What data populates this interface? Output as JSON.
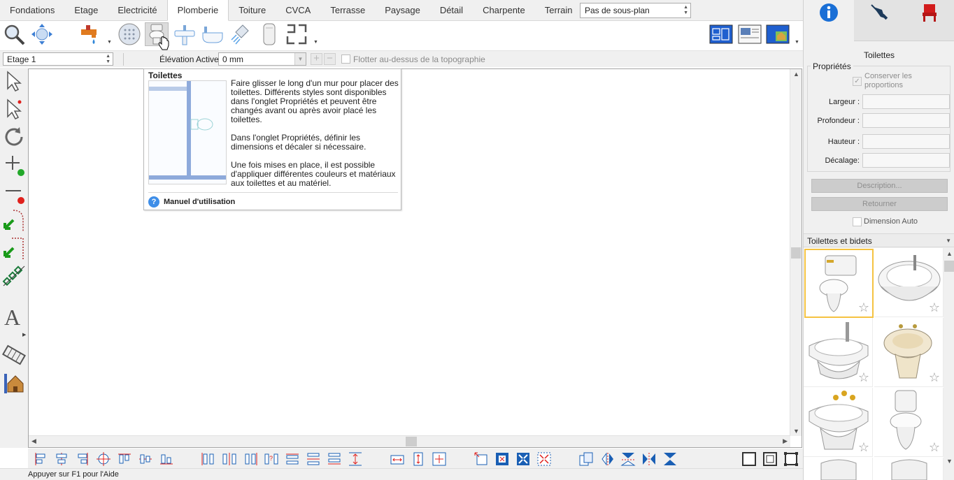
{
  "tabs": [
    "Fondations",
    "Etage",
    "Electricité",
    "Plomberie",
    "Toiture",
    "CVCA",
    "Terrasse",
    "Paysage",
    "Détail",
    "Charpente",
    "Terrain"
  ],
  "active_tab": "Plomberie",
  "plan_select": "Pas de sous-plan",
  "options": {
    "floor": "Etage 1",
    "elevation_label": "Élévation Active:",
    "elevation_value": "0 mm",
    "float_label": "Flotter au-dessus de la topographie"
  },
  "tooltip": {
    "title": "Toilettes",
    "p1": "Faire glisser le long d'un mur pour placer des toilettes. Différents styles sont disponibles dans l'onglet Propriétés et peuvent être changés avant ou après avoir placé les toilettes.",
    "p2": "Dans l'onglet Propriétés, définir les dimensions et décaler si nécessaire.",
    "p3": "Une fois mises en place, il est possible d'appliquer différentes couleurs et matériaux aux toilettes et au matériel.",
    "help": "Manuel d'utilisation"
  },
  "status": "Appuyer sur F1 pour l'Aide",
  "panel": {
    "object_name": "Toilettes",
    "props_title": "Propriétés",
    "keep_proportions": "Conserver les proportions",
    "width_label": "Largeur :",
    "depth_label": "Profondeur :",
    "height_label": "Hauteur :",
    "offset_label": "Décalage:",
    "description_btn": "Description...",
    "back_btn": "Retourner",
    "auto_dim": "Dimension Auto",
    "library_title": "Toilettes et bidets"
  },
  "colors": {
    "accent_blue": "#1a6fd6",
    "selection_yellow": "#f5c341",
    "status_red": "#e0201c",
    "status_green": "#22a82a"
  }
}
